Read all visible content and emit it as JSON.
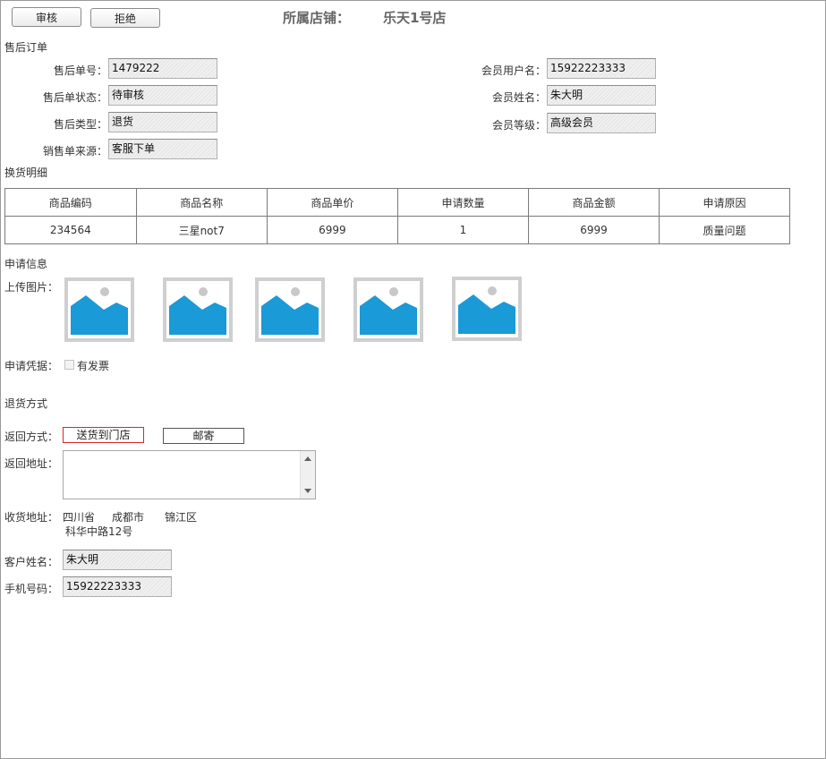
{
  "toolbar": {
    "approve_label": "审核",
    "reject_label": "拒绝"
  },
  "store": {
    "label": "所属店铺：",
    "name": "乐天1号店"
  },
  "order_section": {
    "title": "售后订单",
    "after_sale_no_label": "售后单号：",
    "after_sale_no": "1479222",
    "status_label": "售后单状态：",
    "status": "待审核",
    "type_label": "售后类型：",
    "type": "退货",
    "source_label": "销售单来源：",
    "source": "客服下单",
    "member_username_label": "会员用户名：",
    "member_username": "15922223333",
    "member_name_label": "会员姓名：",
    "member_name": "朱大明",
    "member_level_label": "会员等级：",
    "member_level": "高级会员"
  },
  "detail_section": {
    "title": "换货明细",
    "columns": [
      "商品编码",
      "商品名称",
      "商品单价",
      "申请数量",
      "商品金额",
      "申请原因"
    ],
    "rows": [
      [
        "234564",
        "三星not7",
        "6999",
        "1",
        "6999",
        "质量问题"
      ]
    ]
  },
  "apply_section": {
    "title": "申请信息",
    "upload_label": "上传图片：",
    "images": [
      "image-placeholder",
      "image-placeholder",
      "image-placeholder",
      "image-placeholder",
      "image-placeholder"
    ],
    "evidence_label": "申请凭据：",
    "invoice_label": "有发票"
  },
  "return_section": {
    "title": "退货方式",
    "method_label": "返回方式：",
    "method_store": "送货到门店",
    "method_mail": "邮寄",
    "address_label": "返回地址：",
    "address_value": "",
    "receive_label": "收货地址：",
    "province": "四川省",
    "city": "成都市",
    "district": "锦江区",
    "street": "科华中路12号",
    "customer_name_label": "客户姓名：",
    "customer_name": "朱大明",
    "phone_label": "手机号码：",
    "phone": "15922223333"
  },
  "colors": {
    "selected_border": "#d9262b",
    "image_blue": "#1a9ad6",
    "image_frame": "#cfcfcf"
  }
}
